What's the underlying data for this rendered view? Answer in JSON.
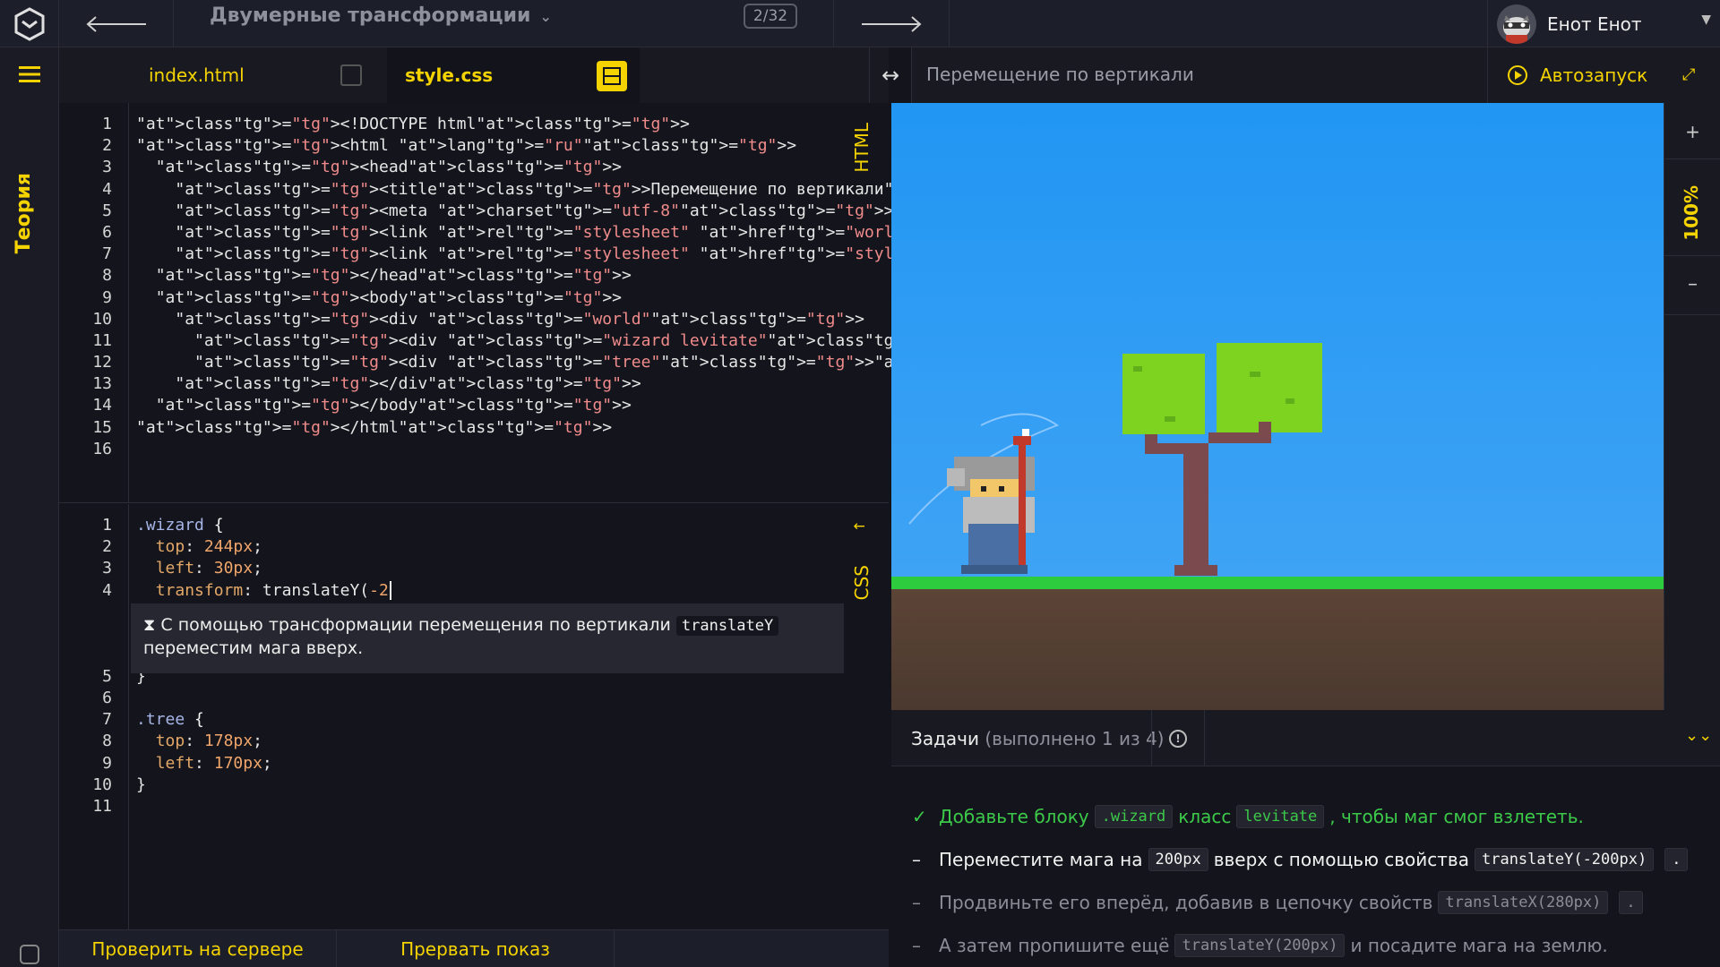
{
  "header": {
    "course_title": "Двумерные трансформации",
    "progress": "2/32",
    "user_name": "Енот Енот"
  },
  "left_rail": {
    "theory_label": "Теория"
  },
  "tabs": {
    "html_tab": "index.html",
    "css_tab": "style.css"
  },
  "editors": {
    "html_label": "HTML",
    "css_label": "CSS"
  },
  "html_lines": [
    "<!DOCTYPE html>",
    "<html lang=\"ru\">",
    "  <head>",
    "    <title>Перемещение по вертикали</title>",
    "    <meta charset=\"utf-8\">",
    "    <link rel=\"stylesheet\" href=\"world.css\">",
    "    <link rel=\"stylesheet\" href=\"style.css\">",
    "  </head>",
    "  <body>",
    "    <div class=\"world\">",
    "      <div class=\"wizard levitate\"></div>",
    "      <div class=\"tree\"></div>",
    "    </div>",
    "  </body>",
    "</html>",
    ""
  ],
  "css_lines": [
    ".wizard {",
    "  top: 244px;",
    "  left: 30px;",
    "  transform: translateY(-2",
    "}",
    "",
    ".tree {",
    "  top: 178px;",
    "  left: 170px;",
    "}",
    ""
  ],
  "hint": {
    "icon": "hourglass-icon",
    "text_before": "С помощью трансформации перемещения по вертикали",
    "code": "translateY",
    "text_after": "переместим мага вверх."
  },
  "bottom": {
    "check_label": "Проверить на сервере",
    "stop_label": "Прервать показ"
  },
  "preview": {
    "title": "Перемещение по вертикали",
    "autorun_label": "Автозапуск",
    "zoom_plus": "+",
    "zoom_level": "100%",
    "zoom_minus": "–"
  },
  "tasks": {
    "title": "Задачи",
    "count": "(выполнено 1 из 4)",
    "items": [
      {
        "status": "done",
        "mark": "✓",
        "parts": [
          "Добавьте блоку",
          ".wizard",
          "класс",
          "levitate",
          ", чтобы маг смог взлететь."
        ]
      },
      {
        "status": "active",
        "mark": "–",
        "parts": [
          "Переместите мага на",
          "200px",
          "вверх с помощью свойства",
          "translateY(-200px)",
          "."
        ]
      },
      {
        "status": "todo",
        "mark": "–",
        "parts": [
          "Продвиньте его вперёд, добавив в цепочку свойств",
          "translateX(280px)",
          "."
        ]
      },
      {
        "status": "todo",
        "mark": "–",
        "parts": [
          "А затем пропишите ещё",
          "translateY(200px)",
          "и посадите мага на землю."
        ]
      }
    ]
  },
  "colors": {
    "accent": "#f5d300",
    "done": "#3cc94a",
    "sky": "#2196f3",
    "grass": "#2ccc3e",
    "ground": "#5c4436"
  }
}
